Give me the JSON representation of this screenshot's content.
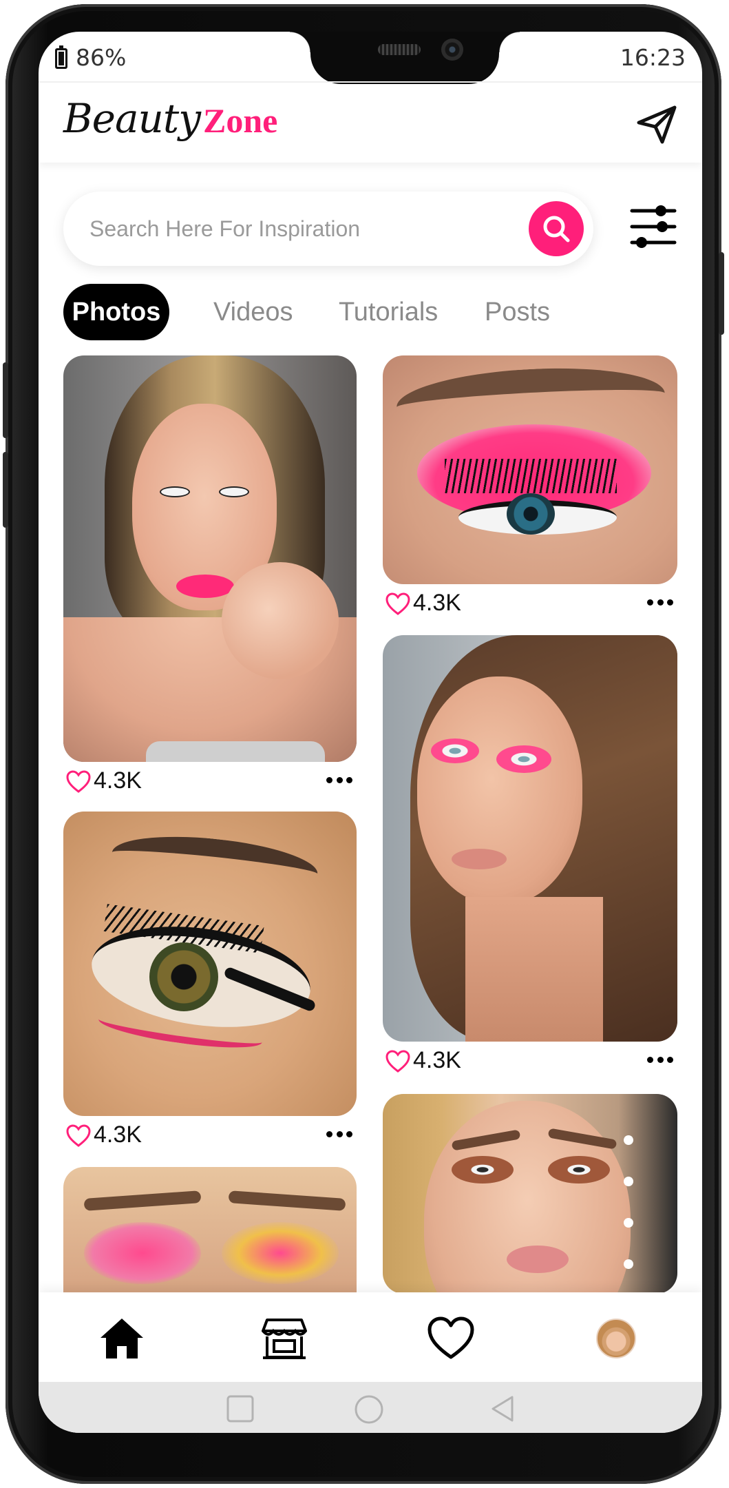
{
  "status_bar": {
    "battery": "86%",
    "time": "16:23"
  },
  "header": {
    "logo_beauty": "Beauty",
    "logo_zone": "Zone",
    "send_icon": "paper-plane-icon"
  },
  "search": {
    "placeholder": "Search Here For Inspiration",
    "icon": "search-icon",
    "filter_icon": "sliders-icon"
  },
  "tabs": [
    {
      "label": "Photos",
      "active": true
    },
    {
      "label": "Videos",
      "active": false
    },
    {
      "label": "Tutorials",
      "active": false
    },
    {
      "label": "Posts",
      "active": false
    }
  ],
  "feed": {
    "left": [
      {
        "subject": "Portrait with pink lipstick",
        "likes": "4.3K"
      },
      {
        "subject": "Eye close-up with winged liner and pink lower liner",
        "likes": "4.3K"
      },
      {
        "subject": "Pink eyeshadow close-up"
      }
    ],
    "right": [
      {
        "subject": "Eye close-up with bright pink eyeshadow",
        "likes": "4.3K"
      },
      {
        "subject": "Portrait with pink eye makeup and wavy hair",
        "likes": "4.3K"
      },
      {
        "subject": "Portrait with glowing makeup"
      }
    ]
  },
  "bottom_nav": [
    {
      "icon": "home-icon",
      "active": true
    },
    {
      "icon": "store-icon",
      "active": false
    },
    {
      "icon": "heart-icon",
      "active": false
    },
    {
      "icon": "profile-avatar",
      "active": false
    }
  ],
  "colors": {
    "accent": "#ff1f7a",
    "text": "#111111",
    "muted": "#8a8a8a"
  }
}
